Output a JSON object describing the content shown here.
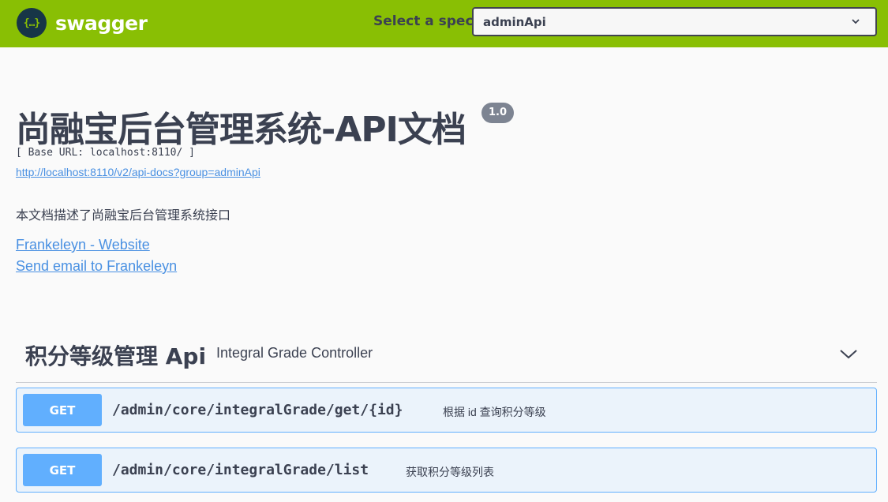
{
  "topbar": {
    "logo_glyph": "{…}",
    "logo_text": "swagger",
    "spec_label": "Select a spec",
    "spec_selected": "adminApi",
    "background": "#89bf04"
  },
  "info": {
    "title": "尚融宝后台管理系统-API文档",
    "version": "1.0",
    "base_url": "[ Base URL: localhost:8110/ ]",
    "api_docs_url": "http://localhost:8110/v2/api-docs?group=adminApi",
    "description": "本文档描述了尚融宝后台管理系统接口",
    "contact_website": "Frankeleyn - Website",
    "contact_email": "Send email to Frankeleyn"
  },
  "tag": {
    "name": "积分等级管理 Api",
    "description": "Integral Grade Controller",
    "icon": "chevron-down-icon"
  },
  "operations": [
    {
      "method": "GET",
      "path": "/admin/core/integralGrade/get/{id}",
      "summary": "根据 id 查询积分等级",
      "color": "#61affe"
    },
    {
      "method": "GET",
      "path": "/admin/core/integralGrade/list",
      "summary": "获取积分等级列表",
      "color": "#61affe"
    }
  ]
}
